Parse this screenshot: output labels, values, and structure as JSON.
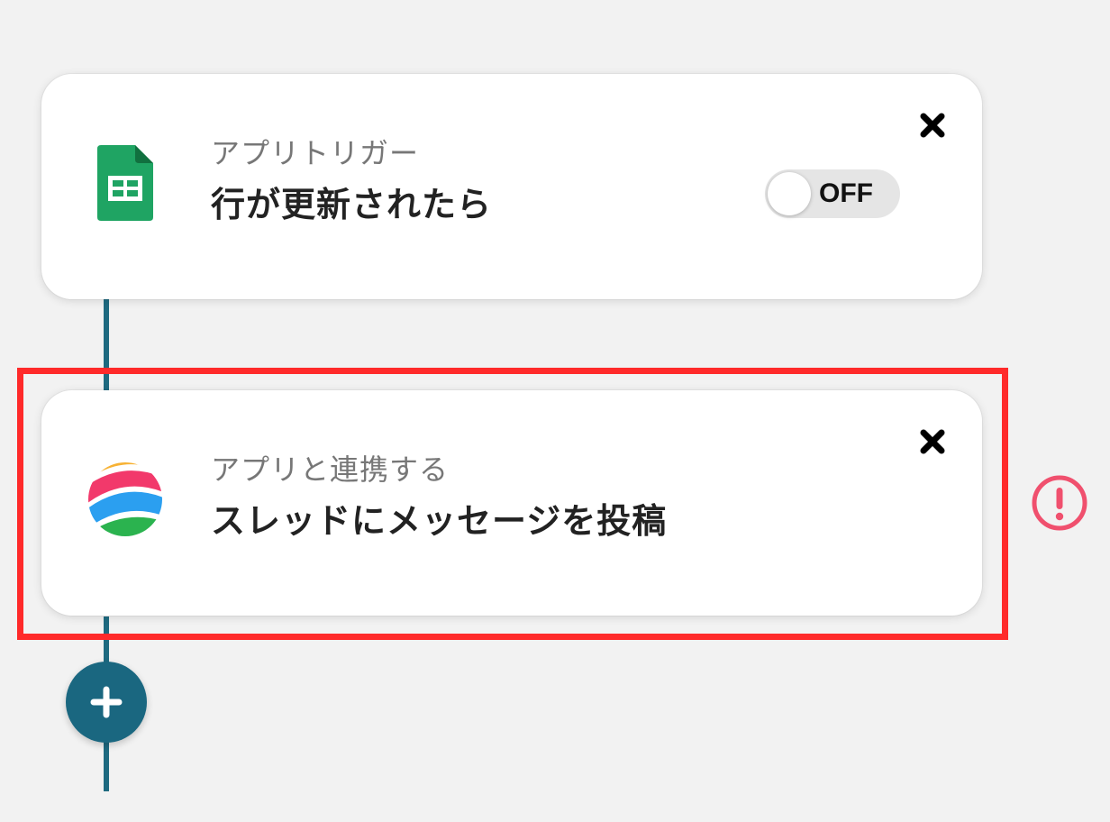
{
  "trigger_card": {
    "app_icon": "google-sheets-icon",
    "subtitle": "アプリトリガー",
    "title": "行が更新されたら",
    "toggle_label": "OFF",
    "close_icon": "close-x-icon"
  },
  "action_card": {
    "app_icon": "threads-app-icon",
    "subtitle": "アプリと連携する",
    "title": "スレッドにメッセージを投稿",
    "close_icon": "close-x-icon",
    "warning_icon": "alert-circle-icon"
  },
  "add_step": {
    "icon": "plus-icon"
  },
  "colors": {
    "background": "#f2f2f2",
    "connector": "#1e6a80",
    "add_button": "#1a6780",
    "highlight": "#ff2a2a",
    "warning": "#f0506e",
    "sheets_green": "#1fa463"
  }
}
